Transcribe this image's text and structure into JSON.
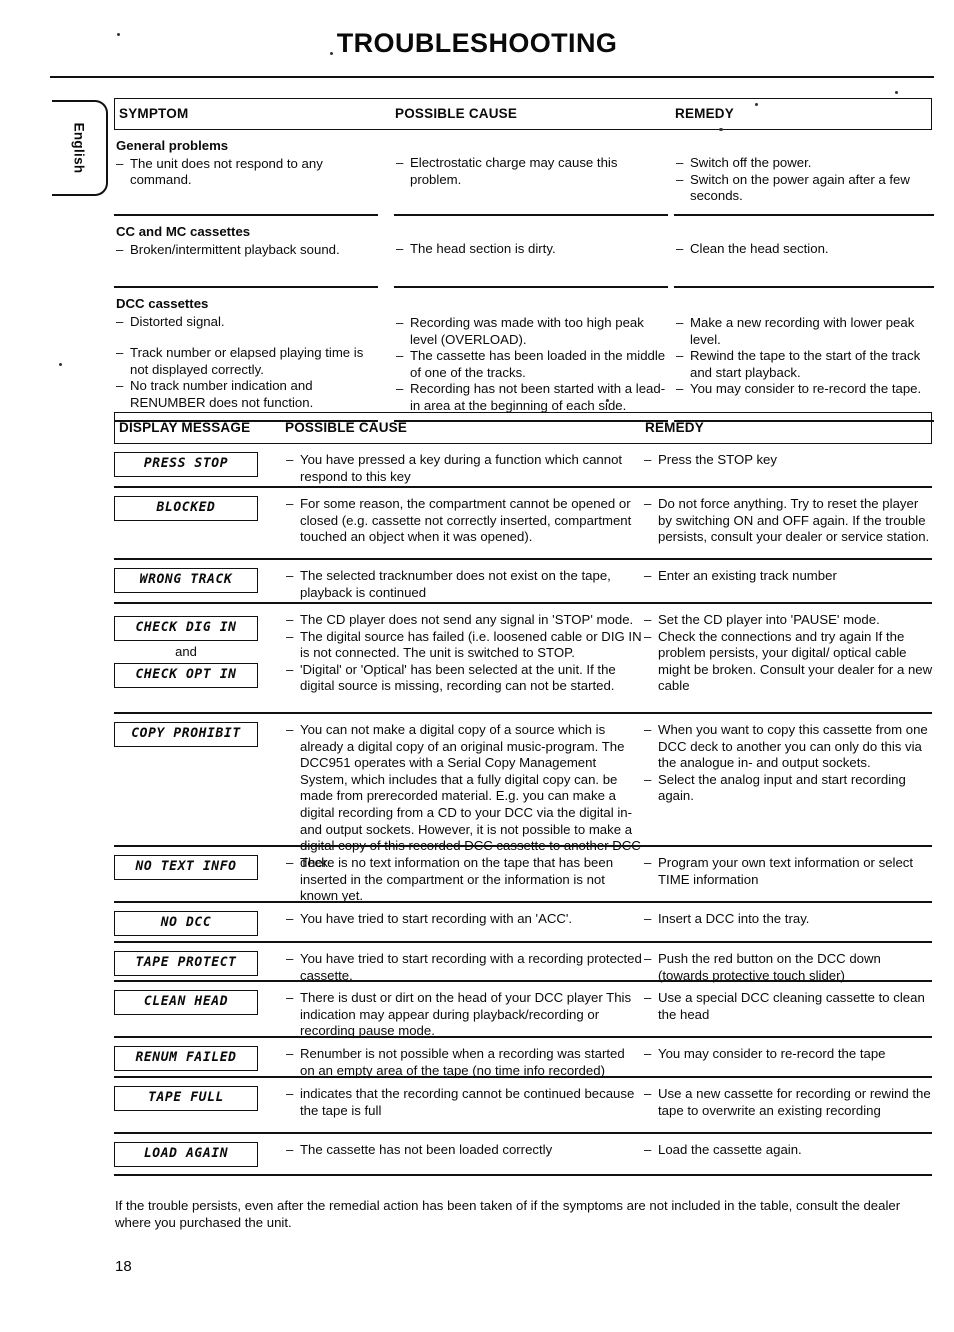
{
  "page": {
    "title": "TROUBLESHOOTING",
    "language_tab": "English",
    "page_number": "18",
    "footer_note": "If the trouble persists, even after the remedial action has been taken of if the symptoms are not included in the table, consult the dealer where you purchased the unit."
  },
  "symptom_table": {
    "headers": {
      "col1": "SYMPTOM",
      "col2": "POSSIBLE CAUSE",
      "col3": "REMEDY"
    },
    "rows": [
      {
        "group": "General problems",
        "symptoms": [
          "The unit does not respond to any command."
        ],
        "causes": [
          "Electrostatic charge may cause this problem."
        ],
        "remedies": [
          "Switch off the power.",
          "Switch on the power again after a few seconds."
        ]
      },
      {
        "group": "CC and MC cassettes",
        "symptoms": [
          "Broken/intermittent playback sound."
        ],
        "causes": [
          "The head section is dirty."
        ],
        "remedies": [
          "Clean the head section."
        ]
      },
      {
        "group": "DCC cassettes",
        "symptoms": [
          "Distorted signal.",
          "Track number or elapsed playing time is not displayed correctly.",
          "No track number indication and RENUMBER does not function."
        ],
        "causes": [
          "Recording was made with too high peak level (OVERLOAD).",
          "The cassette has been loaded in the middle of one of the tracks.",
          "Recording has not been started with a lead-in area at the beginning of each side."
        ],
        "remedies": [
          "Make a new recording with lower peak level.",
          "Rewind the tape to the start of the track and start playback.",
          "You may consider to re-record the tape."
        ]
      }
    ]
  },
  "display_table": {
    "headers": {
      "col1": "DISPLAY MESSAGE",
      "col2": "POSSIBLE CAUSE",
      "col3": "REMEDY"
    },
    "rows": [
      {
        "messages": [
          "PRESS STOP"
        ],
        "connector": "",
        "causes": [
          "You have pressed a key during a function which cannot respond to this key"
        ],
        "remedies": [
          "Press the STOP key"
        ]
      },
      {
        "messages": [
          "BLOCKED"
        ],
        "connector": "",
        "causes": [
          "For some reason, the compartment cannot be opened or closed (e.g. cassette not correctly inserted, compartment touched an object when it was opened)."
        ],
        "remedies": [
          "Do not force anything. Try to reset the player by switching ON and OFF again. If the trouble persists, consult your dealer or service station."
        ]
      },
      {
        "messages": [
          "WRONG TRACK"
        ],
        "connector": "",
        "causes": [
          "The selected tracknumber does not exist on the tape, playback is continued"
        ],
        "remedies": [
          "Enter an existing track number"
        ]
      },
      {
        "messages": [
          "CHECK DIG IN",
          "CHECK OPT IN"
        ],
        "connector": "and",
        "causes": [
          "The CD player does not send any signal in 'STOP' mode.",
          "The digital source has failed (i.e. loosened cable or DIG IN is not connected. The unit is switched to STOP.",
          "'Digital' or 'Optical' has been selected at the unit. If the digital source is missing, recording can not be started."
        ],
        "remedies": [
          "Set the CD player into 'PAUSE' mode.",
          "Check the connections and try again If the problem persists, your digital/ optical cable might be broken. Consult your dealer for a new cable"
        ]
      },
      {
        "messages": [
          "COPY PROHIBIT"
        ],
        "connector": "",
        "causes": [
          "You can not make a digital copy of a source which is already a digital copy of an original music-program. The DCC951 operates with a Serial Copy Management System, which includes that a fully digital copy can. be made from prerecorded material. E.g. you can make a digital recording from a CD to your DCC via the digital in- and output sockets. However, it is not possible to make a digital copy of this recorded DCC cassette to another DCC deck."
        ],
        "remedies": [
          "When you want to copy this cassette from one DCC deck to another you can only do this via the analogue in- and output sockets.",
          "Select the analog input and start recording again."
        ]
      },
      {
        "messages": [
          "NO TEXT INFO"
        ],
        "connector": "",
        "causes": [
          "There is no text information on the tape that has been inserted in the compartment or the information is not known yet."
        ],
        "remedies": [
          "Program your own text information or select TIME information"
        ]
      },
      {
        "messages": [
          "NO DCC"
        ],
        "connector": "",
        "causes": [
          "You have tried to start recording with an 'ACC'."
        ],
        "remedies": [
          "Insert a DCC into the tray."
        ]
      },
      {
        "messages": [
          "TAPE PROTECT"
        ],
        "connector": "",
        "causes": [
          "You have tried to start recording with a recording protected cassette."
        ],
        "remedies": [
          "Push the red button on the DCC down (towards protective touch slider)"
        ]
      },
      {
        "messages": [
          "CLEAN HEAD"
        ],
        "connector": "",
        "causes": [
          "There is dust or dirt on the head of your DCC player This indication may appear during playback/recording or recording pause mode."
        ],
        "remedies": [
          "Use a special DCC cleaning cassette to clean the head"
        ]
      },
      {
        "messages": [
          "RENUM FAILED"
        ],
        "connector": "",
        "causes": [
          "Renumber is not possible when a recording was started on an empty area of the tape (no time info recorded)"
        ],
        "remedies": [
          "You may consider to re-record the tape"
        ]
      },
      {
        "messages": [
          "TAPE FULL"
        ],
        "connector": "",
        "causes": [
          "indicates that the recording cannot be continued because the tape is full"
        ],
        "remedies": [
          "Use a new cassette for recording or rewind the tape to overwrite an existing recording"
        ]
      },
      {
        "messages": [
          "LOAD AGAIN"
        ],
        "connector": "",
        "causes": [
          "The cassette has not been loaded correctly"
        ],
        "remedies": [
          "Load the cassette again."
        ]
      }
    ]
  }
}
